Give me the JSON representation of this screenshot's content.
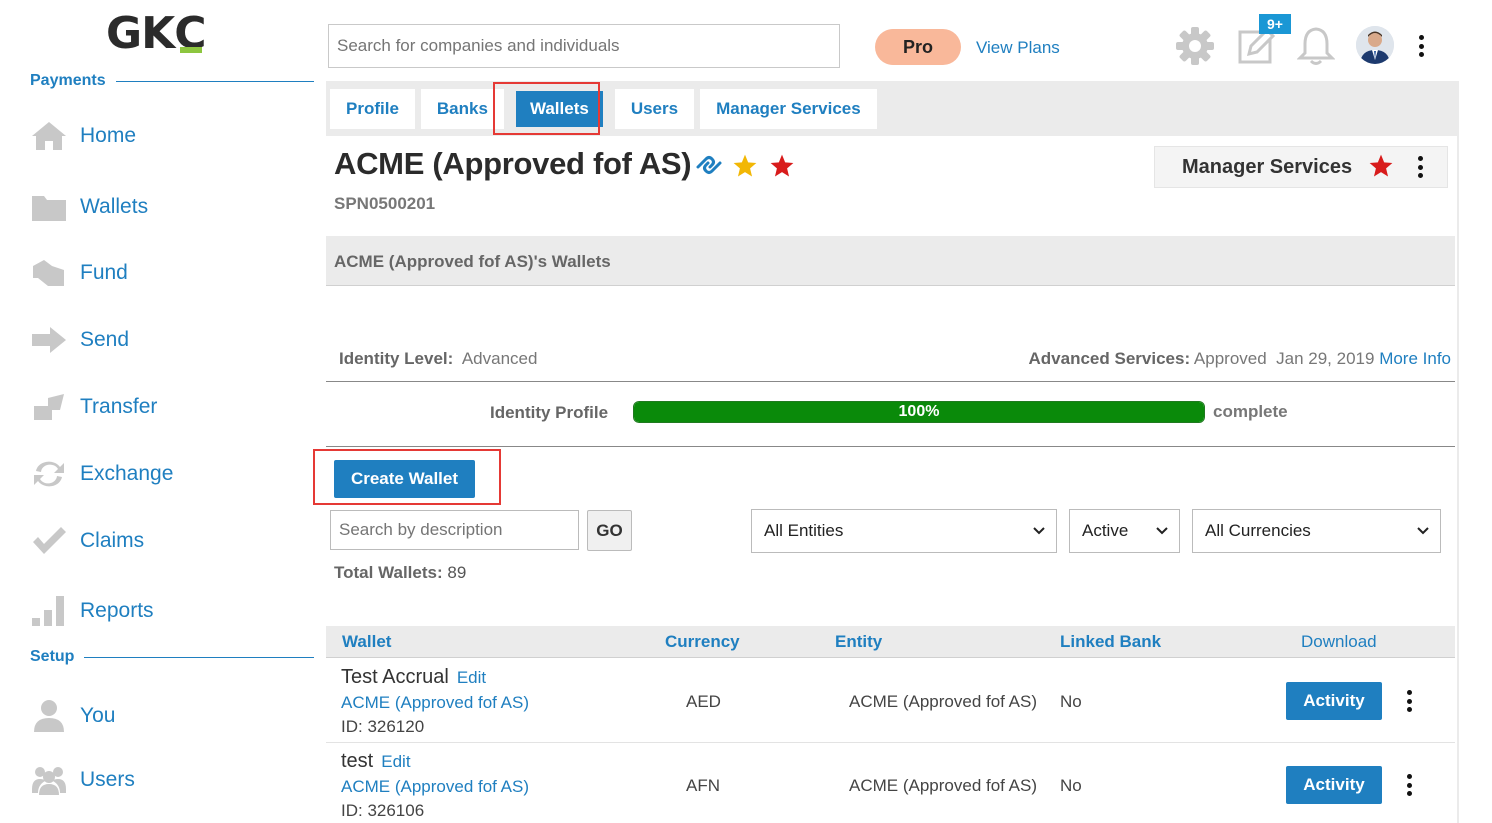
{
  "logo": {
    "text_gk": "GK",
    "text_c": "C"
  },
  "sidebar": {
    "payments_label": "Payments",
    "setup_label": "Setup",
    "items": [
      {
        "label": "Home",
        "icon": "home-icon"
      },
      {
        "label": "Wallets",
        "icon": "folder-icon"
      },
      {
        "label": "Fund",
        "icon": "fund-icon"
      },
      {
        "label": "Send",
        "icon": "arrow-right-icon"
      },
      {
        "label": "Transfer",
        "icon": "transfer-icon"
      },
      {
        "label": "Exchange",
        "icon": "exchange-icon"
      },
      {
        "label": "Claims",
        "icon": "check-icon"
      },
      {
        "label": "Reports",
        "icon": "bar-chart-icon"
      }
    ],
    "setup_items": [
      {
        "label": "You",
        "icon": "user-icon"
      },
      {
        "label": "Users",
        "icon": "users-icon"
      }
    ]
  },
  "topbar": {
    "search_placeholder": "Search for companies and individuals",
    "pro_label": "Pro",
    "view_plans": "View Plans",
    "notif_badge": "9+"
  },
  "tabs": [
    {
      "label": "Profile"
    },
    {
      "label": "Banks"
    },
    {
      "label": "Wallets",
      "active": true
    },
    {
      "label": "Users"
    },
    {
      "label": "Manager Services"
    }
  ],
  "entity": {
    "name": "ACME (Approved fof AS)",
    "id": "SPN0500201",
    "manager_services": "Manager Services"
  },
  "wallets_section": {
    "header": "ACME (Approved fof AS)'s Wallets",
    "identity_level_label": "Identity Level:",
    "identity_level_value": "Advanced",
    "advanced_services_label": "Advanced Services:",
    "advanced_services_value": "Approved",
    "advanced_services_date": "Jan 29, 2019",
    "more_info": "More Info",
    "identity_profile_label": "Identity Profile",
    "progress_percent": 100,
    "progress_text": "100%",
    "progress_after": "complete"
  },
  "controls": {
    "create_wallet": "Create Wallet",
    "desc_placeholder": "Search by description",
    "go": "GO",
    "entities_select": "All Entities",
    "status_select": "Active",
    "currencies_select": "All Currencies",
    "total_label": "Total Wallets:",
    "total_value": "89"
  },
  "table": {
    "headers": {
      "wallet": "Wallet",
      "currency": "Currency",
      "entity": "Entity",
      "linked_bank": "Linked Bank",
      "download": "Download"
    },
    "rows": [
      {
        "name": "Test Accrual",
        "edit": "Edit",
        "entity_link": "ACME (Approved fof AS)",
        "id": "ID: 326120",
        "currency": "AED",
        "entity": "ACME (Approved fof AS)",
        "linked_bank": "No",
        "action": "Activity"
      },
      {
        "name": "test",
        "edit": "Edit",
        "entity_link": "ACME (Approved fof AS)",
        "id": "ID: 326106",
        "currency": "AFN",
        "entity": "ACME (Approved fof AS)",
        "linked_bank": "No",
        "action": "Activity"
      }
    ]
  },
  "colors": {
    "accent": "#1f7fc0",
    "pro": "#f9b89a",
    "progress": "#0a8a0a",
    "highlight": "#e53935",
    "star_gold": "#f2b705",
    "star_red": "#d81b1b"
  }
}
